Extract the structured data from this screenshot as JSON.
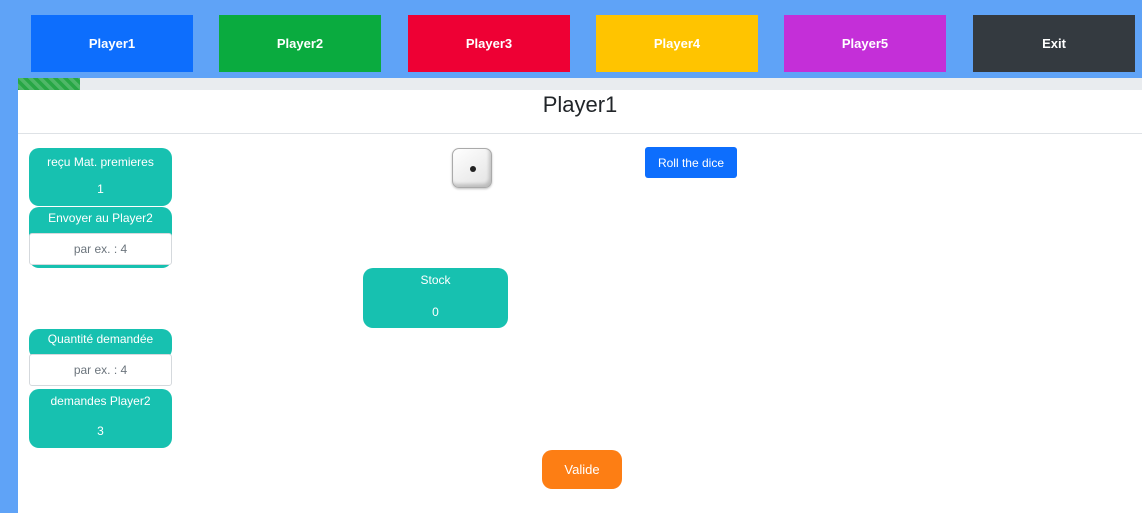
{
  "nav": {
    "buttons": [
      {
        "label": "Player1",
        "color": "#0d6efd"
      },
      {
        "label": "Player2",
        "color": "#0aab3f"
      },
      {
        "label": "Player3",
        "color": "#ee0034"
      },
      {
        "label": "Player4",
        "color": "#ffc400"
      },
      {
        "label": "Player5",
        "color": "#c42fd8"
      },
      {
        "label": "Exit",
        "color": "#343a40"
      }
    ]
  },
  "progress": {
    "fraction": 0.055,
    "color": "#28a745"
  },
  "page": {
    "title": "Player1"
  },
  "received": {
    "label": "reçu Mat. premieres",
    "value": "1"
  },
  "send": {
    "label": "Envoyer au Player2",
    "placeholder": "par ex. : 4"
  },
  "stock": {
    "label": "Stock",
    "value": "0"
  },
  "requested": {
    "label": "Quantité demandée",
    "placeholder": "par ex. : 4"
  },
  "demands": {
    "label": "demandes Player2",
    "value": "3"
  },
  "dice": {
    "icon": "dice-one-icon",
    "face": 1
  },
  "actions": {
    "roll_label": "Roll the dice",
    "valide_label": "Valide"
  },
  "colors": {
    "card": "#17c1b0",
    "roll": "#0d6efd",
    "valide": "#fd7e14",
    "frame": "#5fa3f7"
  }
}
